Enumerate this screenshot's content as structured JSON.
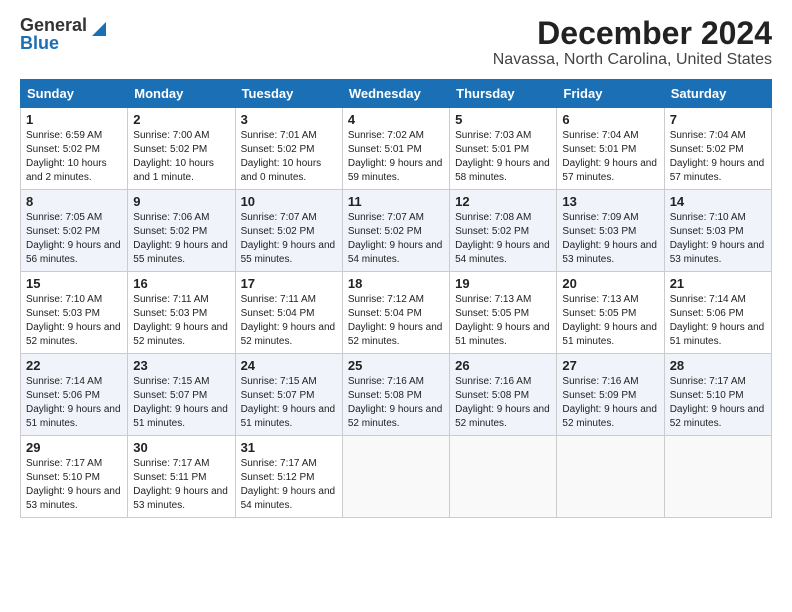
{
  "header": {
    "logo_general": "General",
    "logo_blue": "Blue",
    "title": "December 2024",
    "subtitle": "Navassa, North Carolina, United States"
  },
  "weekdays": [
    "Sunday",
    "Monday",
    "Tuesday",
    "Wednesday",
    "Thursday",
    "Friday",
    "Saturday"
  ],
  "weeks": [
    [
      {
        "day": "1",
        "sunrise": "Sunrise: 6:59 AM",
        "sunset": "Sunset: 5:02 PM",
        "daylight": "Daylight: 10 hours and 2 minutes."
      },
      {
        "day": "2",
        "sunrise": "Sunrise: 7:00 AM",
        "sunset": "Sunset: 5:02 PM",
        "daylight": "Daylight: 10 hours and 1 minute."
      },
      {
        "day": "3",
        "sunrise": "Sunrise: 7:01 AM",
        "sunset": "Sunset: 5:02 PM",
        "daylight": "Daylight: 10 hours and 0 minutes."
      },
      {
        "day": "4",
        "sunrise": "Sunrise: 7:02 AM",
        "sunset": "Sunset: 5:01 PM",
        "daylight": "Daylight: 9 hours and 59 minutes."
      },
      {
        "day": "5",
        "sunrise": "Sunrise: 7:03 AM",
        "sunset": "Sunset: 5:01 PM",
        "daylight": "Daylight: 9 hours and 58 minutes."
      },
      {
        "day": "6",
        "sunrise": "Sunrise: 7:04 AM",
        "sunset": "Sunset: 5:01 PM",
        "daylight": "Daylight: 9 hours and 57 minutes."
      },
      {
        "day": "7",
        "sunrise": "Sunrise: 7:04 AM",
        "sunset": "Sunset: 5:02 PM",
        "daylight": "Daylight: 9 hours and 57 minutes."
      }
    ],
    [
      {
        "day": "8",
        "sunrise": "Sunrise: 7:05 AM",
        "sunset": "Sunset: 5:02 PM",
        "daylight": "Daylight: 9 hours and 56 minutes."
      },
      {
        "day": "9",
        "sunrise": "Sunrise: 7:06 AM",
        "sunset": "Sunset: 5:02 PM",
        "daylight": "Daylight: 9 hours and 55 minutes."
      },
      {
        "day": "10",
        "sunrise": "Sunrise: 7:07 AM",
        "sunset": "Sunset: 5:02 PM",
        "daylight": "Daylight: 9 hours and 55 minutes."
      },
      {
        "day": "11",
        "sunrise": "Sunrise: 7:07 AM",
        "sunset": "Sunset: 5:02 PM",
        "daylight": "Daylight: 9 hours and 54 minutes."
      },
      {
        "day": "12",
        "sunrise": "Sunrise: 7:08 AM",
        "sunset": "Sunset: 5:02 PM",
        "daylight": "Daylight: 9 hours and 54 minutes."
      },
      {
        "day": "13",
        "sunrise": "Sunrise: 7:09 AM",
        "sunset": "Sunset: 5:03 PM",
        "daylight": "Daylight: 9 hours and 53 minutes."
      },
      {
        "day": "14",
        "sunrise": "Sunrise: 7:10 AM",
        "sunset": "Sunset: 5:03 PM",
        "daylight": "Daylight: 9 hours and 53 minutes."
      }
    ],
    [
      {
        "day": "15",
        "sunrise": "Sunrise: 7:10 AM",
        "sunset": "Sunset: 5:03 PM",
        "daylight": "Daylight: 9 hours and 52 minutes."
      },
      {
        "day": "16",
        "sunrise": "Sunrise: 7:11 AM",
        "sunset": "Sunset: 5:03 PM",
        "daylight": "Daylight: 9 hours and 52 minutes."
      },
      {
        "day": "17",
        "sunrise": "Sunrise: 7:11 AM",
        "sunset": "Sunset: 5:04 PM",
        "daylight": "Daylight: 9 hours and 52 minutes."
      },
      {
        "day": "18",
        "sunrise": "Sunrise: 7:12 AM",
        "sunset": "Sunset: 5:04 PM",
        "daylight": "Daylight: 9 hours and 52 minutes."
      },
      {
        "day": "19",
        "sunrise": "Sunrise: 7:13 AM",
        "sunset": "Sunset: 5:05 PM",
        "daylight": "Daylight: 9 hours and 51 minutes."
      },
      {
        "day": "20",
        "sunrise": "Sunrise: 7:13 AM",
        "sunset": "Sunset: 5:05 PM",
        "daylight": "Daylight: 9 hours and 51 minutes."
      },
      {
        "day": "21",
        "sunrise": "Sunrise: 7:14 AM",
        "sunset": "Sunset: 5:06 PM",
        "daylight": "Daylight: 9 hours and 51 minutes."
      }
    ],
    [
      {
        "day": "22",
        "sunrise": "Sunrise: 7:14 AM",
        "sunset": "Sunset: 5:06 PM",
        "daylight": "Daylight: 9 hours and 51 minutes."
      },
      {
        "day": "23",
        "sunrise": "Sunrise: 7:15 AM",
        "sunset": "Sunset: 5:07 PM",
        "daylight": "Daylight: 9 hours and 51 minutes."
      },
      {
        "day": "24",
        "sunrise": "Sunrise: 7:15 AM",
        "sunset": "Sunset: 5:07 PM",
        "daylight": "Daylight: 9 hours and 51 minutes."
      },
      {
        "day": "25",
        "sunrise": "Sunrise: 7:16 AM",
        "sunset": "Sunset: 5:08 PM",
        "daylight": "Daylight: 9 hours and 52 minutes."
      },
      {
        "day": "26",
        "sunrise": "Sunrise: 7:16 AM",
        "sunset": "Sunset: 5:08 PM",
        "daylight": "Daylight: 9 hours and 52 minutes."
      },
      {
        "day": "27",
        "sunrise": "Sunrise: 7:16 AM",
        "sunset": "Sunset: 5:09 PM",
        "daylight": "Daylight: 9 hours and 52 minutes."
      },
      {
        "day": "28",
        "sunrise": "Sunrise: 7:17 AM",
        "sunset": "Sunset: 5:10 PM",
        "daylight": "Daylight: 9 hours and 52 minutes."
      }
    ],
    [
      {
        "day": "29",
        "sunrise": "Sunrise: 7:17 AM",
        "sunset": "Sunset: 5:10 PM",
        "daylight": "Daylight: 9 hours and 53 minutes."
      },
      {
        "day": "30",
        "sunrise": "Sunrise: 7:17 AM",
        "sunset": "Sunset: 5:11 PM",
        "daylight": "Daylight: 9 hours and 53 minutes."
      },
      {
        "day": "31",
        "sunrise": "Sunrise: 7:17 AM",
        "sunset": "Sunset: 5:12 PM",
        "daylight": "Daylight: 9 hours and 54 minutes."
      },
      null,
      null,
      null,
      null
    ]
  ]
}
